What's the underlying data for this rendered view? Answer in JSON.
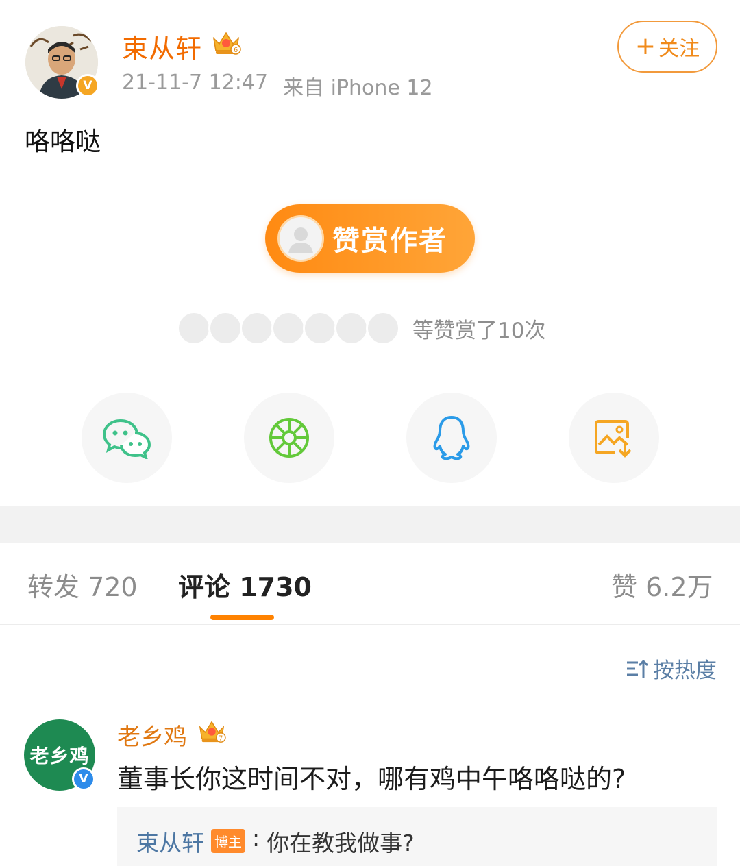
{
  "post": {
    "author": "束从轩",
    "timestamp": "21-11-7 12:47",
    "source": "来自 iPhone 12",
    "follow_label": "关注",
    "text": "咯咯哒"
  },
  "reward": {
    "button_label": "赞赏作者",
    "summary": "等赞赏了10次"
  },
  "share": {
    "items": [
      "wechat-icon",
      "moments-icon",
      "qq-icon",
      "save-image-icon"
    ],
    "colors": {
      "wechat": "#3fc28a",
      "moments": "#63c93a",
      "qq": "#2b9be8",
      "save": "#f5a623"
    }
  },
  "tabs": {
    "repost": "转发 720",
    "comments": "评论 1730",
    "likes": "赞 6.2万"
  },
  "sort_label": "按热度",
  "comment": {
    "avatar_text": "老乡鸡",
    "author": "老乡鸡",
    "text": "董事长你这时间不对，哪有鸡中午咯咯哒的?",
    "reply": {
      "author": "束从轩",
      "tag": "博主",
      "separator": ":",
      "text": "你在教我做事?"
    }
  },
  "colors": {
    "accent": "#ff8200",
    "name_orange": "#f26b00",
    "link_blue": "#5b7fa6"
  }
}
